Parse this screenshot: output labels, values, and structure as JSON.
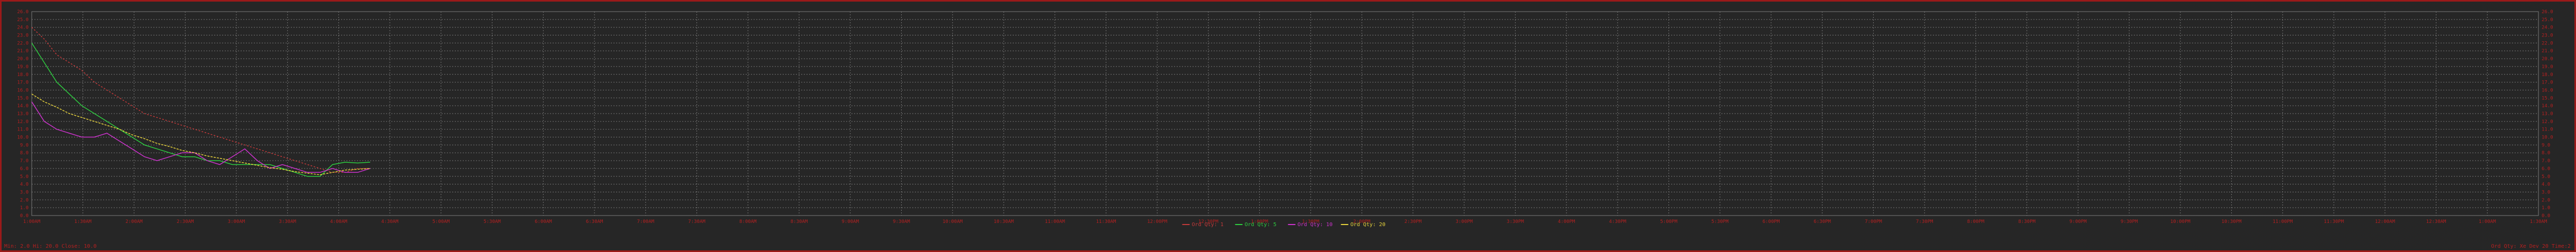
{
  "footer": {
    "left": "Min: 2.0   Hi: 20.0   Close: 10.0",
    "right": "Ord Qty: Xe Dev 20 Time:2"
  },
  "colors": {
    "background": "#262626",
    "frame": "#9b1a1a",
    "axis_text": "#b52020",
    "grid": "#7a7a7a"
  },
  "chart_data": {
    "type": "line",
    "title": "",
    "xlabel": "",
    "ylabel": "",
    "x_range": [
      0,
      100
    ],
    "ylim": [
      0,
      26
    ],
    "y_ticks": [
      "26.0",
      "25.0",
      "24.0",
      "23.0",
      "22.0",
      "21.0",
      "20.0",
      "19.0",
      "18.0",
      "17.0",
      "16.0",
      "15.0",
      "14.0",
      "13.0",
      "12.0",
      "11.0",
      "10.0",
      "9.0",
      "8.0",
      "7.0",
      "6.0",
      "5.0",
      "4.0",
      "3.0",
      "2.0",
      "1.0",
      "0.0"
    ],
    "x_ticks": [
      "1:00AM",
      "1:30AM",
      "2:00AM",
      "2:30AM",
      "3:00AM",
      "3:30AM",
      "4:00AM",
      "4:30AM",
      "5:00AM",
      "5:30AM",
      "6:00AM",
      "6:30AM",
      "7:00AM",
      "7:30AM",
      "8:00AM",
      "8:30AM",
      "9:00AM",
      "9:30AM",
      "10:00AM",
      "10:30AM",
      "11:00AM",
      "11:30AM",
      "12:00PM",
      "12:30PM",
      "1:00PM",
      "1:30PM",
      "2:00PM",
      "2:30PM",
      "3:00PM",
      "3:30PM",
      "4:00PM",
      "4:30PM",
      "5:00PM",
      "5:30PM",
      "6:00PM",
      "6:30PM",
      "7:00PM",
      "7:30PM",
      "8:00PM",
      "8:30PM",
      "9:00PM",
      "9:30PM",
      "10:00PM",
      "10:30PM",
      "11:00PM",
      "11:30PM",
      "12:00AM",
      "12:30AM",
      "1:00AM",
      "1:30AM"
    ],
    "grid": true,
    "legend_position": "bottom-center",
    "series": [
      {
        "name": "Ord Qty: 1",
        "color": "#c23a3a",
        "x": [
          0.0,
          0.5,
          1.0,
          1.5,
          2.0,
          2.5,
          3.0,
          3.5,
          4.0,
          4.5,
          5.0,
          5.5,
          6.0,
          6.5,
          7.0,
          7.5,
          8.0,
          8.5,
          9.0,
          9.5,
          10.0,
          10.5,
          11.0,
          11.5,
          12.0,
          12.5,
          13.0,
          13.5
        ],
        "y": [
          24.0,
          22.5,
          20.5,
          19.5,
          18.5,
          17.0,
          16.0,
          15.0,
          14.0,
          13.0,
          12.5,
          12.0,
          11.5,
          11.0,
          10.5,
          10.0,
          9.5,
          9.0,
          8.5,
          8.0,
          7.5,
          7.0,
          6.5,
          6.0,
          5.5,
          5.5,
          6.0,
          6.0
        ]
      },
      {
        "name": "Ord Qty: 5",
        "color": "#2ecc40",
        "x": [
          0.0,
          0.5,
          1.0,
          1.5,
          2.0,
          2.5,
          3.0,
          3.5,
          4.0,
          4.5,
          5.0,
          5.5,
          6.0,
          6.5,
          7.0,
          7.5,
          8.0,
          8.5,
          9.0,
          9.5,
          10.0,
          10.5,
          11.0,
          11.5,
          12.0,
          12.5,
          13.0,
          13.5
        ],
        "y": [
          22.0,
          19.5,
          17.0,
          15.5,
          14.0,
          13.0,
          12.0,
          11.0,
          10.0,
          9.0,
          8.5,
          8.0,
          7.5,
          7.5,
          7.0,
          7.0,
          6.5,
          6.5,
          6.5,
          6.5,
          6.0,
          5.5,
          5.0,
          5.0,
          6.5,
          6.8,
          6.7,
          6.8
        ]
      },
      {
        "name": "Ord Qty: 10",
        "color": "#cc33cc",
        "x": [
          0.0,
          0.5,
          1.0,
          1.5,
          2.0,
          2.5,
          3.0,
          3.5,
          4.0,
          4.5,
          5.0,
          5.5,
          6.0,
          6.5,
          7.0,
          7.5,
          8.0,
          8.5,
          9.0,
          9.5,
          10.0,
          10.5,
          11.0,
          11.5,
          12.0,
          12.5,
          13.0,
          13.5
        ],
        "y": [
          14.5,
          12.0,
          11.0,
          10.5,
          10.0,
          10.0,
          10.5,
          9.5,
          8.5,
          7.5,
          7.0,
          7.5,
          8.0,
          8.0,
          7.0,
          6.5,
          7.5,
          8.5,
          7.0,
          6.0,
          6.5,
          6.0,
          5.5,
          5.5,
          6.0,
          5.5,
          5.5,
          6.0
        ]
      },
      {
        "name": "Ord Qty: 20",
        "color": "#e6d23c",
        "x": [
          0.0,
          0.5,
          1.0,
          1.5,
          2.0,
          2.5,
          3.0,
          3.5,
          4.0,
          4.5,
          5.0,
          5.5,
          6.0,
          6.5,
          7.0,
          7.5,
          8.0,
          8.5,
          9.0,
          9.5,
          10.0,
          10.5,
          11.0,
          11.5,
          12.0,
          12.5,
          13.0,
          13.5
        ],
        "y": [
          15.5,
          14.5,
          13.8,
          13.0,
          12.5,
          12.0,
          11.5,
          11.0,
          10.3,
          9.8,
          9.2,
          8.8,
          8.3,
          8.0,
          7.6,
          7.3,
          7.0,
          6.7,
          6.4,
          6.1,
          5.9,
          5.6,
          5.4,
          5.2,
          5.5,
          5.8,
          5.9,
          6.0
        ]
      }
    ]
  }
}
